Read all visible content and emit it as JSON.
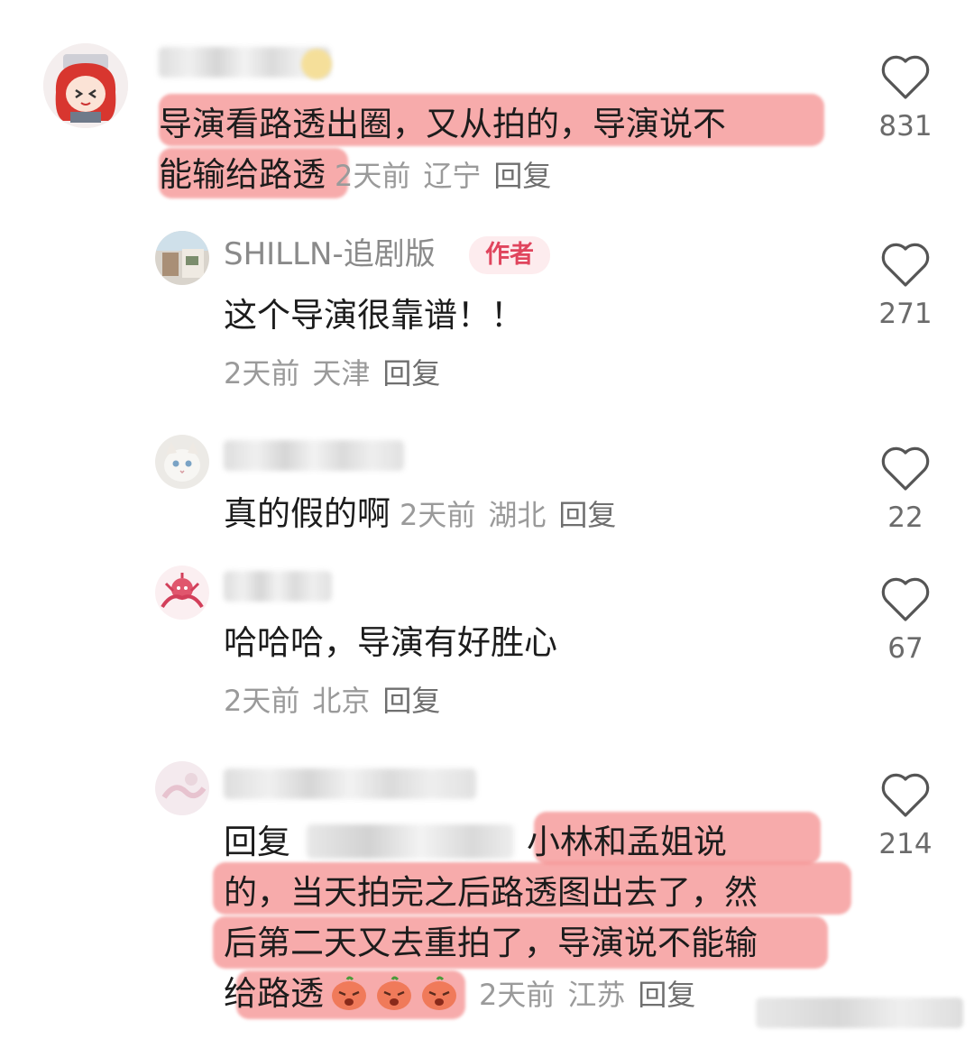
{
  "comments": [
    {
      "text": "导演看路透出圈，又从拍的，导演说不能输给路透",
      "line1": "导演看路透出圈，又从拍的，导演说不",
      "line2": "能输给路透",
      "time": "2天前",
      "location": "辽宁",
      "reply": "回复",
      "likes": "831"
    },
    {
      "name": "SHILLN-追剧版",
      "badge": "作者",
      "text": "这个导演很靠谱！！",
      "time": "2天前",
      "location": "天津",
      "reply": "回复",
      "likes": "271"
    },
    {
      "text": "真的假的啊",
      "time": "2天前",
      "location": "湖北",
      "reply": "回复",
      "likes": "22"
    },
    {
      "text": "哈哈哈，导演有好胜心",
      "time": "2天前",
      "location": "北京",
      "reply": "回复",
      "likes": "67"
    },
    {
      "reply_prefix": "回复",
      "line1": "小林和孟姐说",
      "line2": "的，当天拍完之后路透图出去了，然",
      "line3": "后第二天又去重拍了，导演说不能输",
      "line4": "给路透",
      "time": "2天前",
      "location": "江苏",
      "reply": "回复",
      "likes": "214"
    }
  ],
  "colors": {
    "highlight": "#f27878",
    "badge_text": "#e0455d",
    "badge_bg": "#fdecee",
    "meta": "#9a9a9a"
  },
  "icons": [
    "heart-icon",
    "avatar",
    "angry-emoji-icon"
  ]
}
